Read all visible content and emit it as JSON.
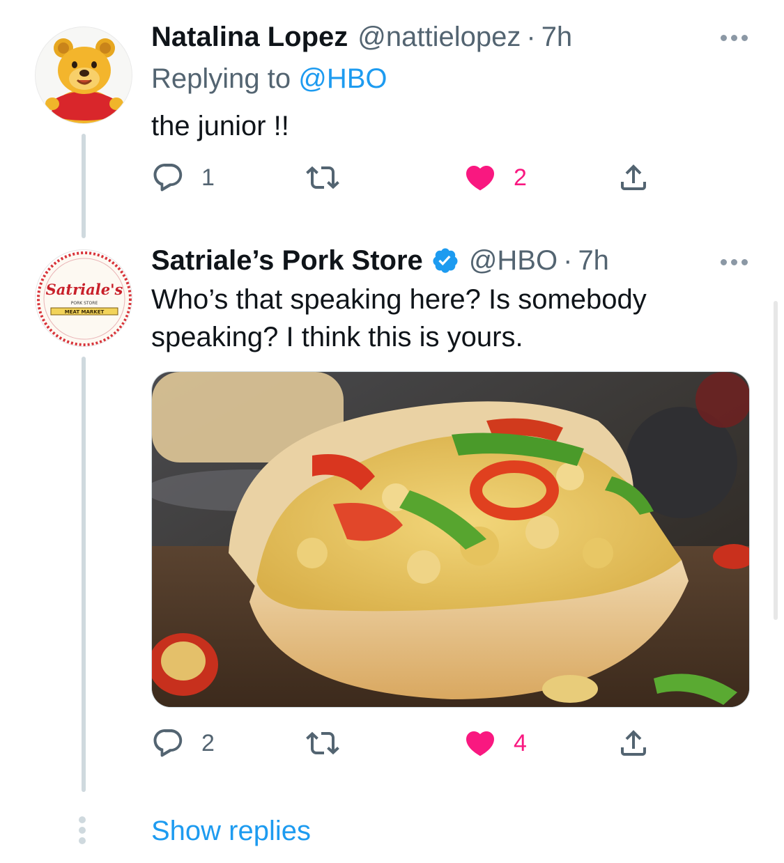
{
  "tweets": [
    {
      "author_name": "Natalina Lopez",
      "handle": "@nattielopez",
      "separator": "·",
      "time": "7h",
      "replying_to_prefix": "Replying to",
      "replying_to_handle": "@HBO",
      "text": "the junior !!",
      "avatar_icon": "winnie-the-pooh-avatar",
      "reply_count": "1",
      "retweet_count": "",
      "like_count": "2",
      "liked": true
    },
    {
      "author_name": "Satriale’s Pork Store",
      "verified": true,
      "handle": "@HBO",
      "separator": "·",
      "time": "7h",
      "text_line1": "Who’s that speaking here? Is somebody",
      "text_line2": "speaking? I think this is yours.",
      "avatar_logo_text": "Satriale's",
      "avatar_logo_subtext": "PORK STORE",
      "avatar_logo_banner": "MEAT MARKET",
      "media_description_icon": "egg-and-pepper-sandwich-photo",
      "reply_count": "2",
      "retweet_count": "",
      "like_count": "4",
      "liked": true
    }
  ],
  "show_replies_label": "Show replies",
  "colors": {
    "accent": "#1d9bf0",
    "like": "#f91880",
    "secondary_text": "#536471",
    "thread_line": "#cfd9de"
  }
}
